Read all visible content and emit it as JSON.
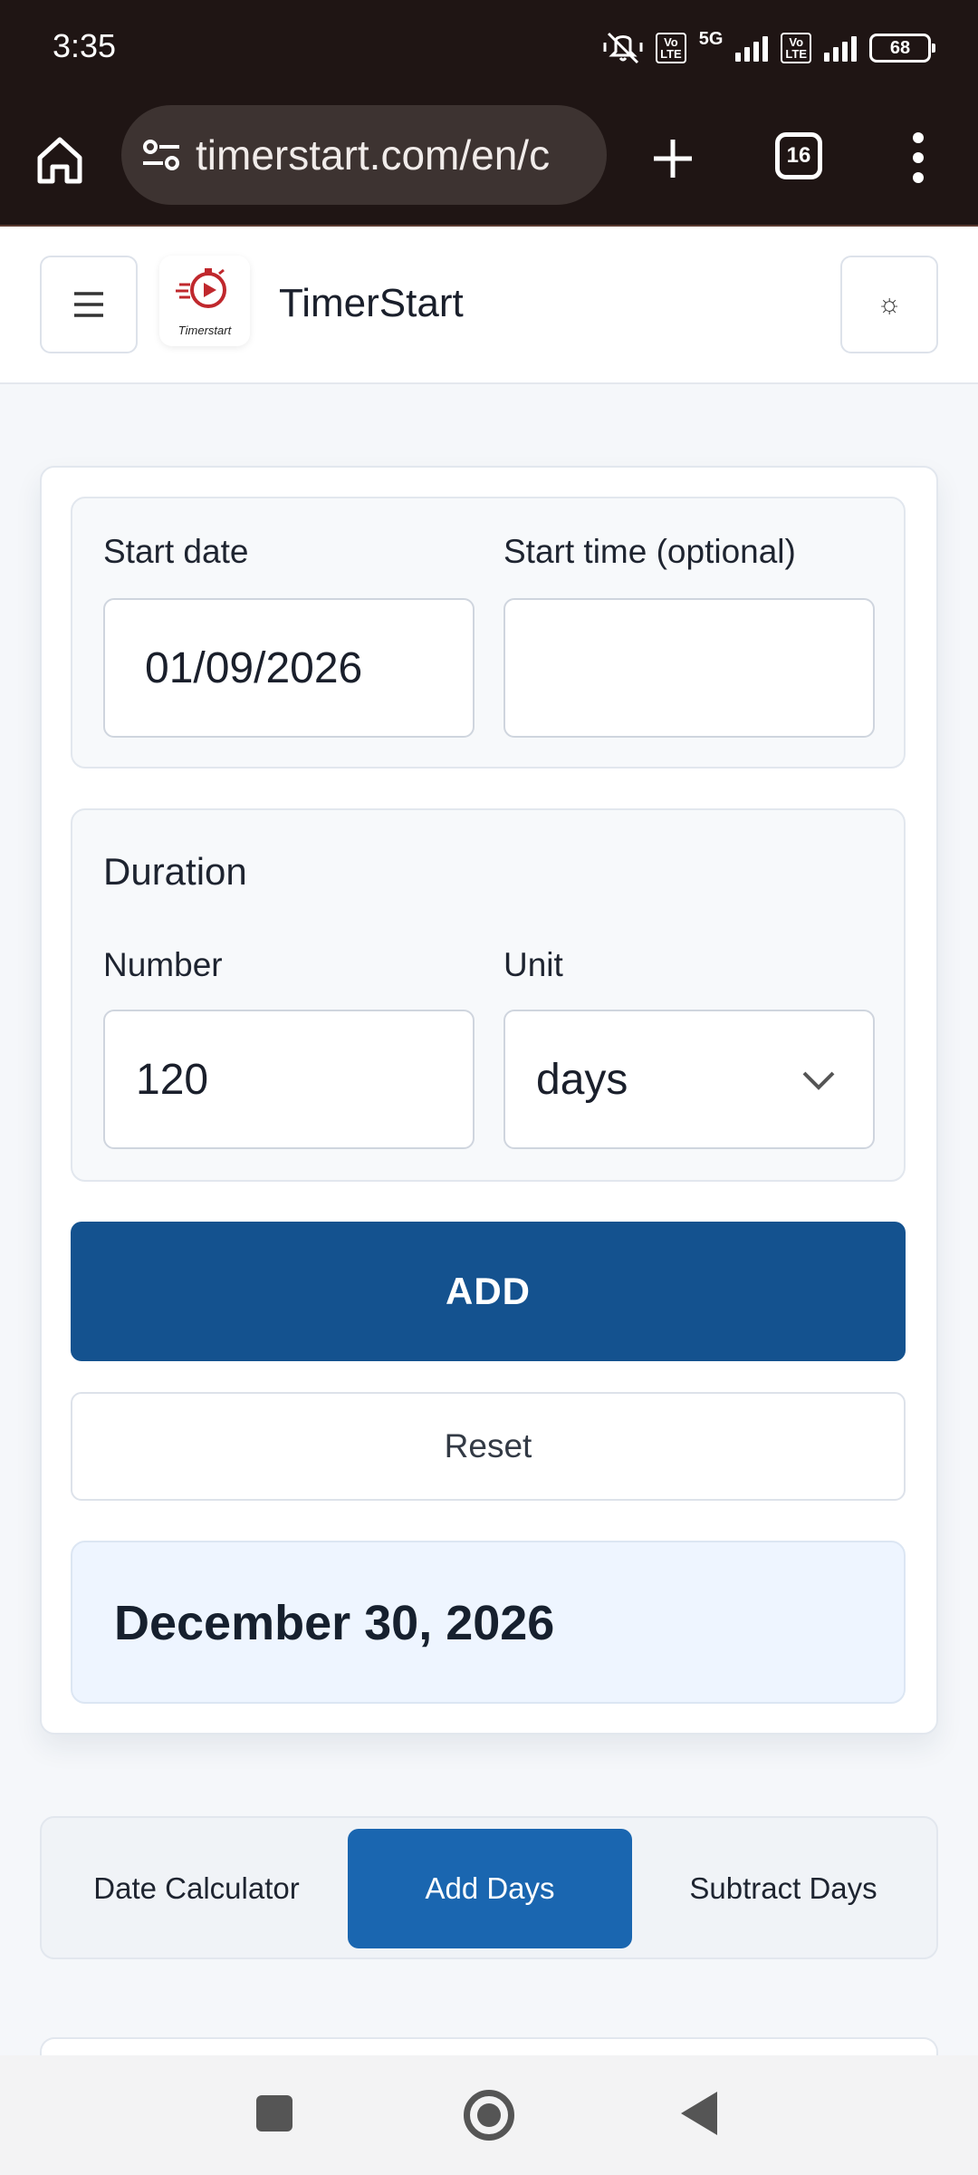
{
  "status_bar": {
    "time": "3:35",
    "network": "5G",
    "volte_label": "Vo\nLTE",
    "battery": "68"
  },
  "browser": {
    "url": "timerstart.com/en/c",
    "tab_count": "16"
  },
  "header": {
    "brand": "TimerStart",
    "logo_text": "Timerstart",
    "menu_icon": "hamburger-icon",
    "theme_icon": "sun-icon",
    "theme_glyph": "☼"
  },
  "form": {
    "start_date_label": "Start date",
    "start_date_value": "01/09/2026",
    "start_time_label": "Start time (optional)",
    "start_time_value": "",
    "duration_heading": "Duration",
    "number_label": "Number",
    "number_value": "120",
    "unit_label": "Unit",
    "unit_value": "days",
    "add_label": "ADD",
    "reset_label": "Reset"
  },
  "result": {
    "date": "December 30, 2026"
  },
  "tabs": [
    {
      "label": "Date Calculator",
      "active": false
    },
    {
      "label": "Add Days",
      "active": true
    },
    {
      "label": "Subtract Days",
      "active": false
    }
  ],
  "colors": {
    "primary": "#14528f",
    "tab_active": "#1a66b0",
    "result_bg": "#eef5ff",
    "browser_bg": "#1f1514"
  }
}
